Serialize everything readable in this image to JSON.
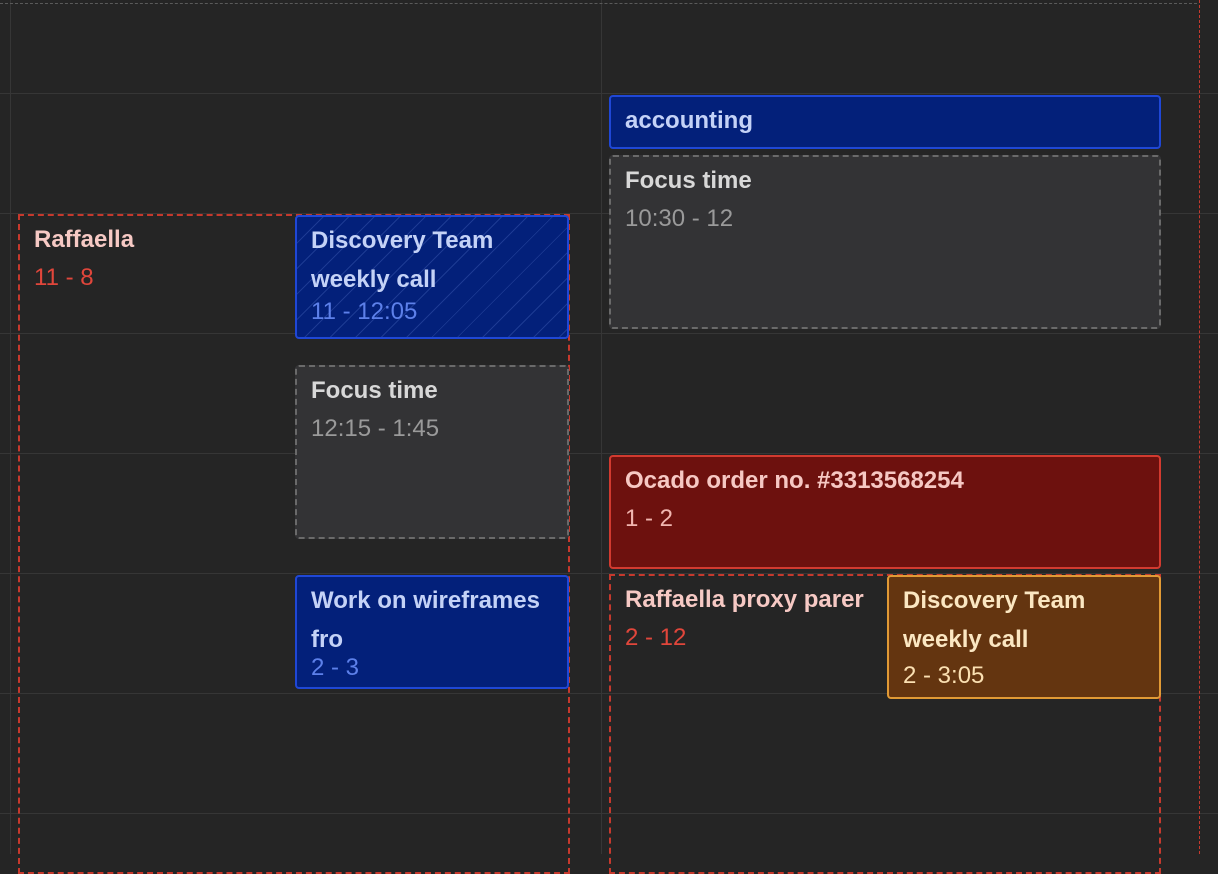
{
  "calendar": {
    "events": [
      {
        "title": "accounting",
        "time": ""
      },
      {
        "title": "Focus time",
        "time": "10:30 - 12"
      },
      {
        "title": "Raffaella",
        "time": "11 - 8"
      },
      {
        "title": "Discovery Team weekly call",
        "time": "11 - 12:05"
      },
      {
        "title": "Focus time",
        "time": "12:15 - 1:45"
      },
      {
        "title": "Ocado order no. #3313568254",
        "time": "1 - 2"
      },
      {
        "title": "Work on wireframes fro",
        "time": "2 - 3"
      },
      {
        "title": "Raffaella proxy parer",
        "time": "2 - 12"
      },
      {
        "title": "Discovery Team weekly call",
        "time": "2 - 3:05"
      }
    ]
  }
}
